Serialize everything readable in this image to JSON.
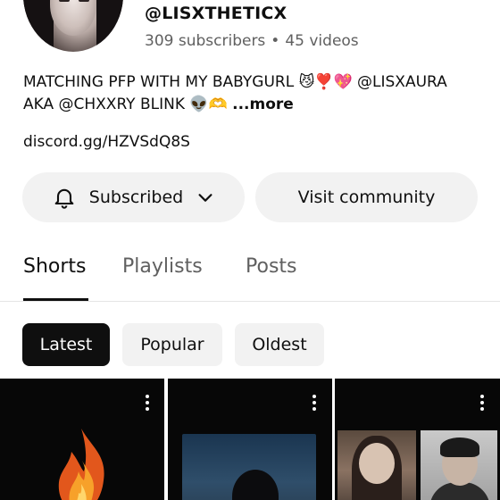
{
  "channel": {
    "handle": "@LISXTHETICX",
    "subscribers": "309 subscribers",
    "separator": "•",
    "videos": "45 videos",
    "description_line1": "MATCHING PFP WITH MY BABYGURL 😼❣️💖 @LISXAURA",
    "description_line2": "AKA @CHXXRY BLINK 👽🫶",
    "more_label": "...more",
    "link": "discord.gg/HZVSdQ8S"
  },
  "actions": {
    "subscribed_label": "Subscribed",
    "visit_community_label": "Visit community",
    "bell_icon": "bell-icon",
    "chevron_icon": "chevron-down-icon"
  },
  "tabs": [
    {
      "label": "Shorts",
      "active": true
    },
    {
      "label": "Playlists",
      "active": false
    },
    {
      "label": "Posts",
      "active": false
    }
  ],
  "filters": [
    {
      "label": "Latest",
      "active": true
    },
    {
      "label": "Popular",
      "active": false
    },
    {
      "label": "Oldest",
      "active": false
    }
  ],
  "colors": {
    "text": "#0f0f0f",
    "secondary_text": "#606060",
    "chip_bg": "#f2f2f2",
    "active_chip_bg": "#0f0f0f"
  }
}
